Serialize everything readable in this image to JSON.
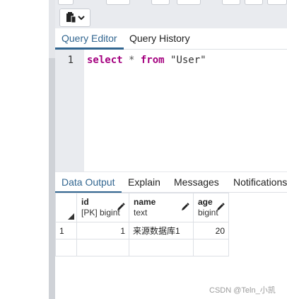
{
  "editor": {
    "tabs": [
      {
        "label": "Query Editor",
        "active": true
      },
      {
        "label": "Query History",
        "active": false
      }
    ],
    "line_number": "1",
    "sql": {
      "kw_select": "select",
      "star": " * ",
      "kw_from": "from",
      "table": " \"User\""
    }
  },
  "results": {
    "tabs": [
      {
        "label": "Data Output",
        "active": true
      },
      {
        "label": "Explain",
        "active": false
      },
      {
        "label": "Messages",
        "active": false
      },
      {
        "label": "Notifications",
        "active": false
      }
    ],
    "columns": [
      {
        "name": "id",
        "type": "[PK] bigint"
      },
      {
        "name": "name",
        "type": "text"
      },
      {
        "name": "age",
        "type": "bigint"
      }
    ],
    "rows": [
      {
        "row_no": "1",
        "id": "1",
        "name": "来源数据库1",
        "age": "20"
      }
    ]
  },
  "colors": {
    "accent": "#326690",
    "keyword": "#a4007f"
  },
  "watermark": "CSDN @Teln_小凯"
}
